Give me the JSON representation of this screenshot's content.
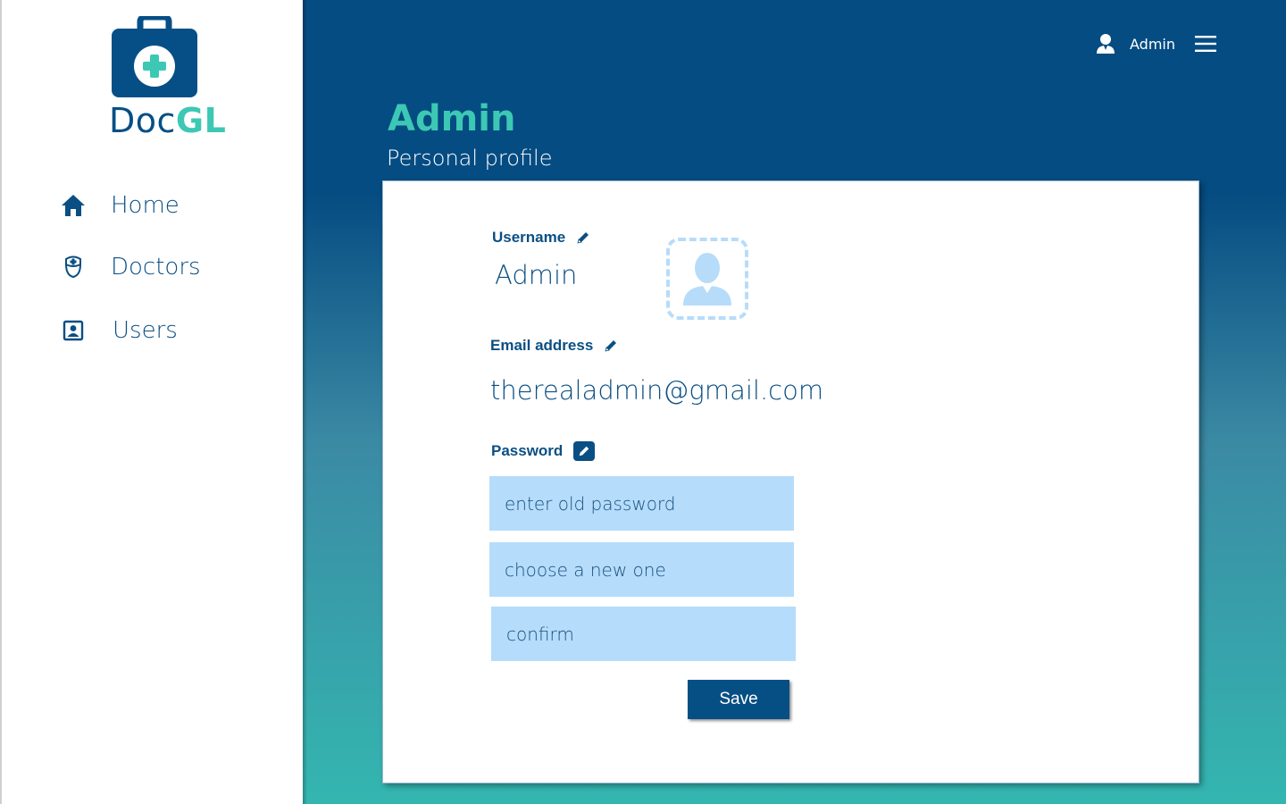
{
  "brand": {
    "name_part1": "Doc",
    "name_part2": "GL",
    "primary_color": "#064f86",
    "accent_color": "#3cc8b4"
  },
  "sidebar": {
    "items": [
      {
        "label": "Home",
        "icon": "home-icon"
      },
      {
        "label": "Doctors",
        "icon": "nurse-icon"
      },
      {
        "label": "Users",
        "icon": "user-card-icon"
      }
    ]
  },
  "topbar": {
    "user_name": "Admin",
    "user_icon": "user-icon",
    "menu_icon": "hamburger-menu-icon"
  },
  "page": {
    "title": "Admin",
    "subtitle": "Personal profile"
  },
  "profile": {
    "username_label": "Username",
    "username_value": "Admin",
    "email_label": "Email address",
    "email_value": "therealadmin@gmail.com",
    "password_label": "Password",
    "old_password_placeholder": "enter old password",
    "new_password_placeholder": "choose a new one",
    "confirm_placeholder": "confirm",
    "save_label": "Save",
    "avatar_icon": "avatar-placeholder-icon",
    "edit_icon": "pencil-icon"
  }
}
